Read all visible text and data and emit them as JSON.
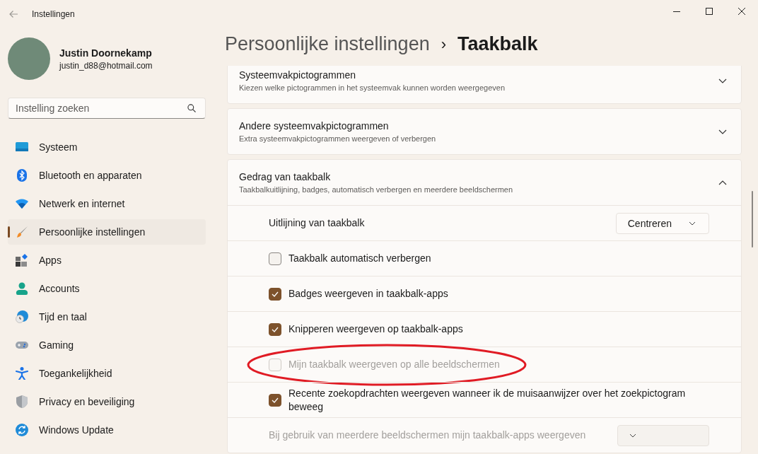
{
  "window": {
    "title": "Instellingen"
  },
  "account": {
    "name": "Justin Doornekamp",
    "email": "justin_d88@hotmail.com"
  },
  "search": {
    "placeholder": "Instelling zoeken"
  },
  "sidebar": {
    "items": [
      {
        "kind": "system",
        "label": "Systeem",
        "selected": false
      },
      {
        "kind": "bluetooth",
        "label": "Bluetooth en apparaten",
        "selected": false
      },
      {
        "kind": "network",
        "label": "Netwerk en internet",
        "selected": false
      },
      {
        "kind": "personalization",
        "label": "Persoonlijke instellingen",
        "selected": true
      },
      {
        "kind": "apps",
        "label": "Apps",
        "selected": false
      },
      {
        "kind": "accounts",
        "label": "Accounts",
        "selected": false
      },
      {
        "kind": "time",
        "label": "Tijd en taal",
        "selected": false
      },
      {
        "kind": "gaming",
        "label": "Gaming",
        "selected": false
      },
      {
        "kind": "accessibility",
        "label": "Toegankelijkheid",
        "selected": false
      },
      {
        "kind": "privacy",
        "label": "Privacy en beveiliging",
        "selected": false
      },
      {
        "kind": "update",
        "label": "Windows Update",
        "selected": false
      }
    ]
  },
  "breadcrumb": {
    "parent": "Persoonlijke instellingen",
    "separator": "›",
    "current": "Taakbalk"
  },
  "sections": [
    {
      "title": "Systeemvakpictogrammen",
      "subtitle": "Kiezen welke pictogrammen in het systeemvak kunnen worden weergegeven",
      "expanded": false
    },
    {
      "title": "Andere systeemvakpictogrammen",
      "subtitle": "Extra systeemvakpictogrammen weergeven of verbergen",
      "expanded": false
    },
    {
      "title": "Gedrag van taakbalk",
      "subtitle": "Taakbalkuitlijning, badges, automatisch verbergen en meerdere beeldschermen",
      "expanded": true,
      "rows": [
        {
          "kind": "dropdown",
          "label": "Uitlijning van taakbalk",
          "value": "Centreren",
          "disabled": false
        },
        {
          "kind": "checkbox",
          "label": "Taakbalk automatisch verbergen",
          "checked": false,
          "disabled": false,
          "highlighted": false
        },
        {
          "kind": "checkbox",
          "label": "Badges weergeven in taakbalk-apps",
          "checked": true,
          "disabled": false,
          "highlighted": false
        },
        {
          "kind": "checkbox",
          "label": "Knipperen weergeven op taakbalk-apps",
          "checked": true,
          "disabled": false,
          "highlighted": false
        },
        {
          "kind": "checkbox",
          "label": "Mijn taakbalk weergeven op alle beeldschermen",
          "checked": false,
          "disabled": true,
          "highlighted": true
        },
        {
          "kind": "checkbox",
          "label": "Recente zoekopdrachten weergeven wanneer ik de muisaanwijzer over het zoekpictogram beweeg",
          "checked": true,
          "disabled": false,
          "highlighted": false
        },
        {
          "kind": "dropdown",
          "label": "Bij gebruik van meerdere beeldschermen mijn taakbalk-apps weergeven",
          "disabled": true
        }
      ]
    }
  ]
}
